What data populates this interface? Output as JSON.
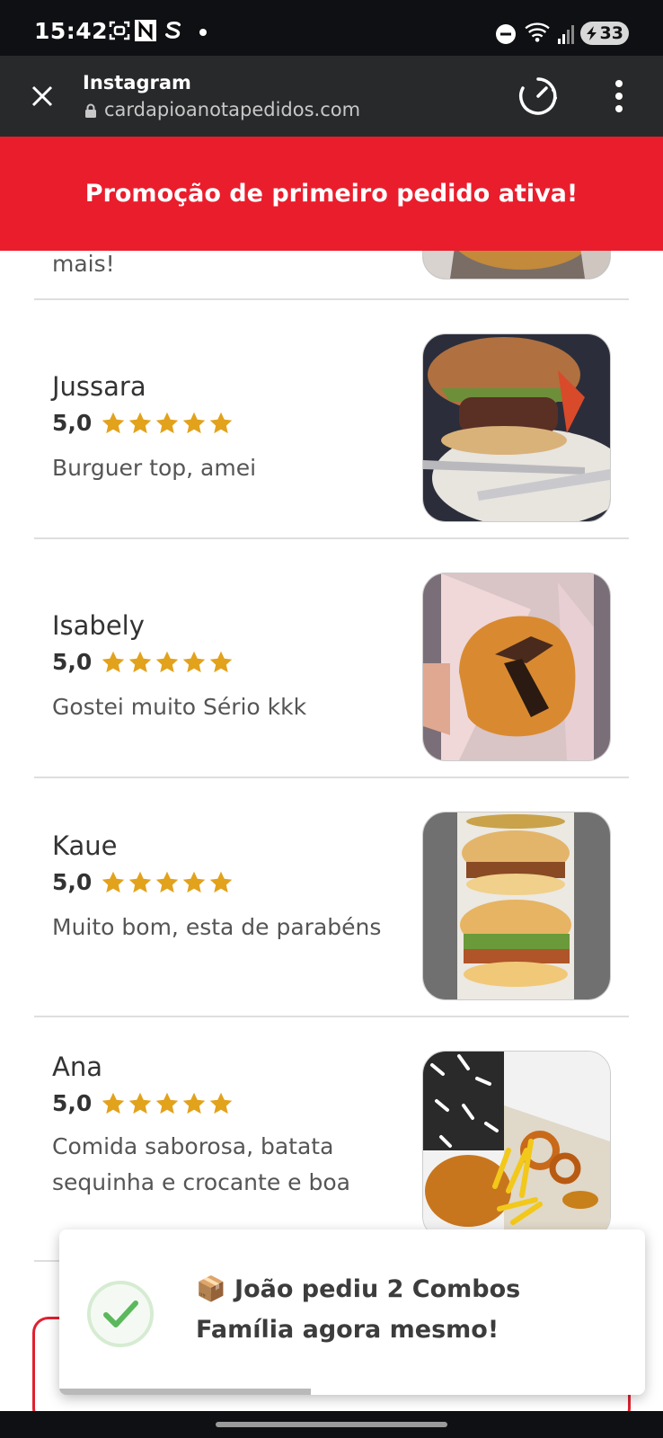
{
  "status_bar": {
    "time": "15:42",
    "battery": "33"
  },
  "browser": {
    "title": "Instagram",
    "url": "cardapioanotapedidos.com"
  },
  "promo_banner": "Promoção de primeiro pedido ativa!",
  "partial_review_text": "mais!",
  "reviews": [
    {
      "name": "Jussara",
      "rating": "5,0",
      "stars": 5,
      "text": "Burguer top, amei"
    },
    {
      "name": "Isabely",
      "rating": "5,0",
      "stars": 5,
      "text": "Gostei muito Sério kkk"
    },
    {
      "name": "Kaue",
      "rating": "5,0",
      "stars": 5,
      "text": "Muito bom, esta de parabéns"
    },
    {
      "name": "Ana",
      "rating": "5,0",
      "stars": 5,
      "text": "Comida saborosa, batata sequinha e crocante e boa"
    }
  ],
  "toast": {
    "icon": "package-emoji",
    "message": "📦 João pediu 2 Combos Família agora mesmo!",
    "progress": 0.43
  },
  "colors": {
    "promo_red": "#ea1d2c",
    "star_gold": "#e2a21c",
    "check_green": "#5cb85c"
  }
}
